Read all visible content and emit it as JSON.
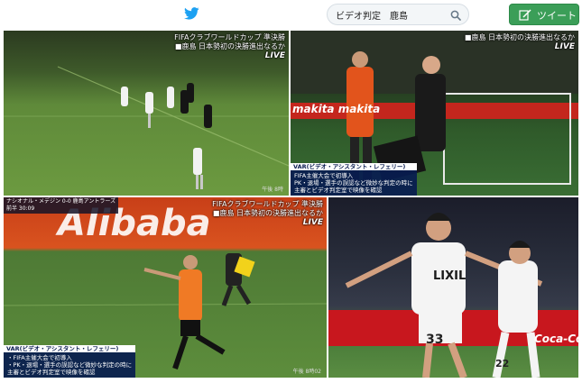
{
  "header": {
    "logo_icon": "twitter-bird-icon",
    "brand_color": "#1da1f2",
    "search": {
      "value": "ビデオ判定　鹿島",
      "icon": "search-icon"
    },
    "tweet_button": {
      "label": "ツイート",
      "icon": "compose-tweet-icon",
      "color": "#3b9e58"
    }
  },
  "tiles": [
    {
      "overlay_line1": "FIFAクラブワールドカップ 準決勝",
      "overlay_line2": "■鹿島 日本勢初の決勝進出なるか",
      "overlay_live": "LIVE",
      "time": "午後 8時"
    },
    {
      "overlay_line1": "■鹿島 日本勢初の決勝進出なるか",
      "overlay_live": "LIVE",
      "ad_board": "makita  makita",
      "caption_head": "VAR(ビデオ・アシスタント・レフェリー)",
      "caption_line1": "FIFA主催大会で初導入",
      "caption_line2": "PK・退場・選手の誤認など微妙な判定の時に",
      "caption_line3": "主審とビデオ判定室で映像を確認"
    },
    {
      "scorebug": "ナシオナル・メデジン  0-0  鹿島アントラーズ",
      "scorebug_time": "前半 30:09",
      "overlay_line1": "FIFAクラブワールドカップ 準決勝",
      "overlay_line2": "■鹿島 日本勢初の決勝進出なるか",
      "overlay_live": "LIVE",
      "ad_board": "Alibaba",
      "caption_head": "VAR(ビデオ・アシスタント・レフェリー)",
      "caption_line1": "・FIFA主催大会で初導入",
      "caption_line2": "・PK・退場・選手の誤認など微妙な判定の時に",
      "caption_line3": "主審とビデオ判定室で映像を確認",
      "time": "午後 8時02"
    },
    {
      "sponsor": "LIXIL",
      "number_left": "33",
      "number_right": "22",
      "ad_board": "Coca-Cola"
    }
  ]
}
